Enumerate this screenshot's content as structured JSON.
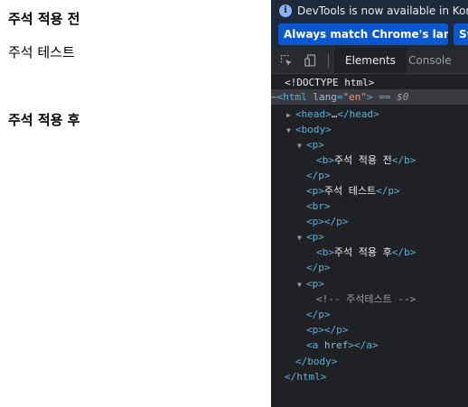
{
  "page": {
    "heading_before": "주석 적용 전",
    "text_line": "주석 테스트",
    "heading_after": "주석 적용 후"
  },
  "devtools": {
    "notice": "DevTools is now available in Korean!",
    "language_button": "Always match Chrome's language",
    "switch_button": "Sw",
    "tabs": [
      "Elements",
      "Console"
    ],
    "tree": {
      "doctype": "<!DOCTYPE html>",
      "html_open": "<html",
      "html_attr": "lang",
      "html_eq": "=",
      "html_val": "\"en\"",
      "html_close": ">",
      "equals_marker": " == ",
      "dollar": "$0",
      "head": "<head>",
      "head_dots": "…",
      "head_end": "</head>",
      "body": "<body>",
      "p_open": "<p>",
      "b_open": "<b>",
      "b_text_1": "주석 적용 전",
      "b_close": "</b>",
      "p_close": "</p>",
      "p_text": "주석 테스트",
      "br": "<br>",
      "p_empty": "</p>",
      "b_text_2": "주석 적용 후",
      "comment": "<!-- 주석테스트 -->",
      "a_open": "<a",
      "a_attr": "href",
      "a_close_tag": "></a>",
      "body_close": "</body>",
      "html_end": "</html>"
    }
  }
}
